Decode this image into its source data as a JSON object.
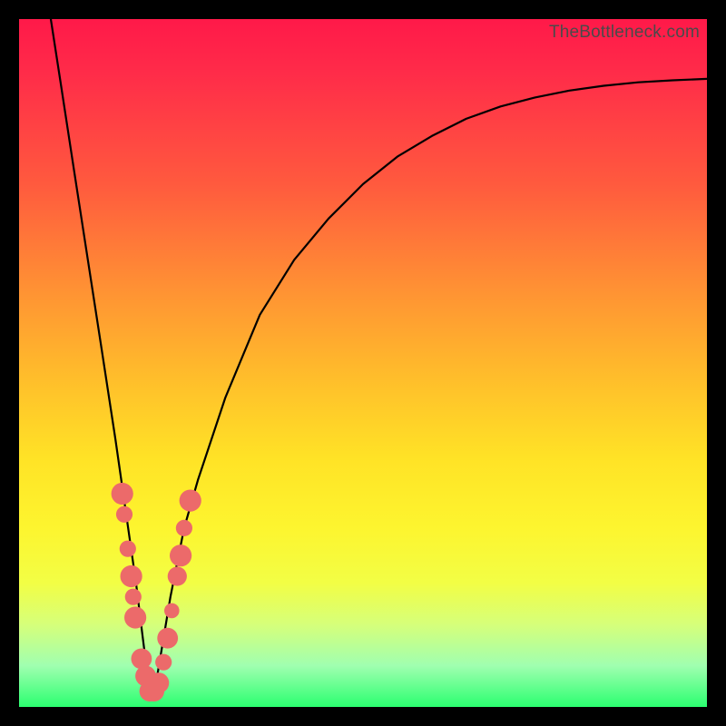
{
  "watermark": "TheBottleneck.com",
  "chart_data": {
    "type": "line",
    "title": "",
    "xlabel": "",
    "ylabel": "",
    "xlim": [
      0,
      100
    ],
    "ylim": [
      0,
      100
    ],
    "grid": false,
    "legend": false,
    "note": "V-shaped bottleneck curve; minimum (bottleneck=0) near x≈19. Values estimated from curve with no axis labels present in image.",
    "series": [
      {
        "name": "bottleneck",
        "x": [
          0,
          2,
          4,
          6,
          8,
          10,
          12,
          14,
          15,
          16,
          17,
          18,
          19,
          20,
          21,
          22,
          24,
          26,
          30,
          35,
          40,
          45,
          50,
          55,
          60,
          65,
          70,
          75,
          80,
          85,
          90,
          95,
          100
        ],
        "y": [
          130,
          117,
          104,
          91,
          78,
          65,
          52,
          39,
          32,
          25,
          18,
          10,
          2,
          4,
          10,
          16,
          26,
          33,
          45,
          57,
          65,
          71,
          76,
          80,
          83,
          85.5,
          87.3,
          88.6,
          89.6,
          90.3,
          90.8,
          91.1,
          91.3
        ]
      }
    ],
    "markers": [
      {
        "x": 15.0,
        "y": 31,
        "r": 1.6
      },
      {
        "x": 15.3,
        "y": 28,
        "r": 1.2
      },
      {
        "x": 15.8,
        "y": 23,
        "r": 1.2
      },
      {
        "x": 16.3,
        "y": 19,
        "r": 1.6
      },
      {
        "x": 16.6,
        "y": 16,
        "r": 1.2
      },
      {
        "x": 16.9,
        "y": 13,
        "r": 1.6
      },
      {
        "x": 17.8,
        "y": 7,
        "r": 1.5
      },
      {
        "x": 18.4,
        "y": 4.5,
        "r": 1.5
      },
      {
        "x": 19.0,
        "y": 2.3,
        "r": 1.5
      },
      {
        "x": 19.6,
        "y": 2.3,
        "r": 1.5
      },
      {
        "x": 20.3,
        "y": 3.5,
        "r": 1.5
      },
      {
        "x": 21.0,
        "y": 6.5,
        "r": 1.2
      },
      {
        "x": 21.6,
        "y": 10,
        "r": 1.5
      },
      {
        "x": 22.2,
        "y": 14,
        "r": 1.1
      },
      {
        "x": 23.0,
        "y": 19,
        "r": 1.4
      },
      {
        "x": 23.5,
        "y": 22,
        "r": 1.6
      },
      {
        "x": 24.0,
        "y": 26,
        "r": 1.2
      },
      {
        "x": 24.9,
        "y": 30,
        "r": 1.6
      }
    ]
  }
}
